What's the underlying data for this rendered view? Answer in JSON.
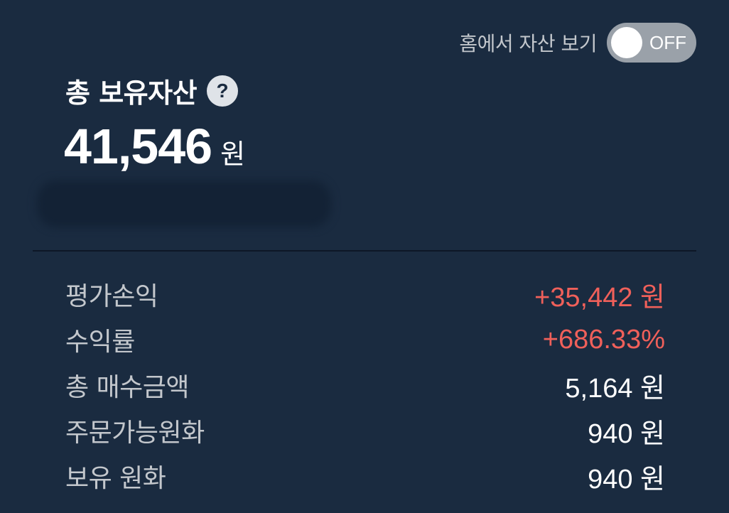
{
  "home_toggle": {
    "label": "홈에서 자산 보기",
    "state": "OFF"
  },
  "total_assets": {
    "title": "총 보유자산",
    "help_icon": "?",
    "amount": "41,546",
    "unit": "원"
  },
  "summary": [
    {
      "label": "평가손익",
      "value": "+35,442 원",
      "status": "positive"
    },
    {
      "label": "수익률",
      "value": "+686.33%",
      "status": "positive"
    },
    {
      "label": "총 매수금액",
      "value": "5,164 원",
      "status": "neutral"
    },
    {
      "label": "주문가능원화",
      "value": "940 원",
      "status": "neutral"
    },
    {
      "label": "보유 원화",
      "value": "940 원",
      "status": "neutral"
    }
  ],
  "colors": {
    "background": "#1a2b40",
    "positive": "#f0605a",
    "toggle_off": "#9aa1a9"
  },
  "icons": {
    "help": "question-circle-icon"
  }
}
